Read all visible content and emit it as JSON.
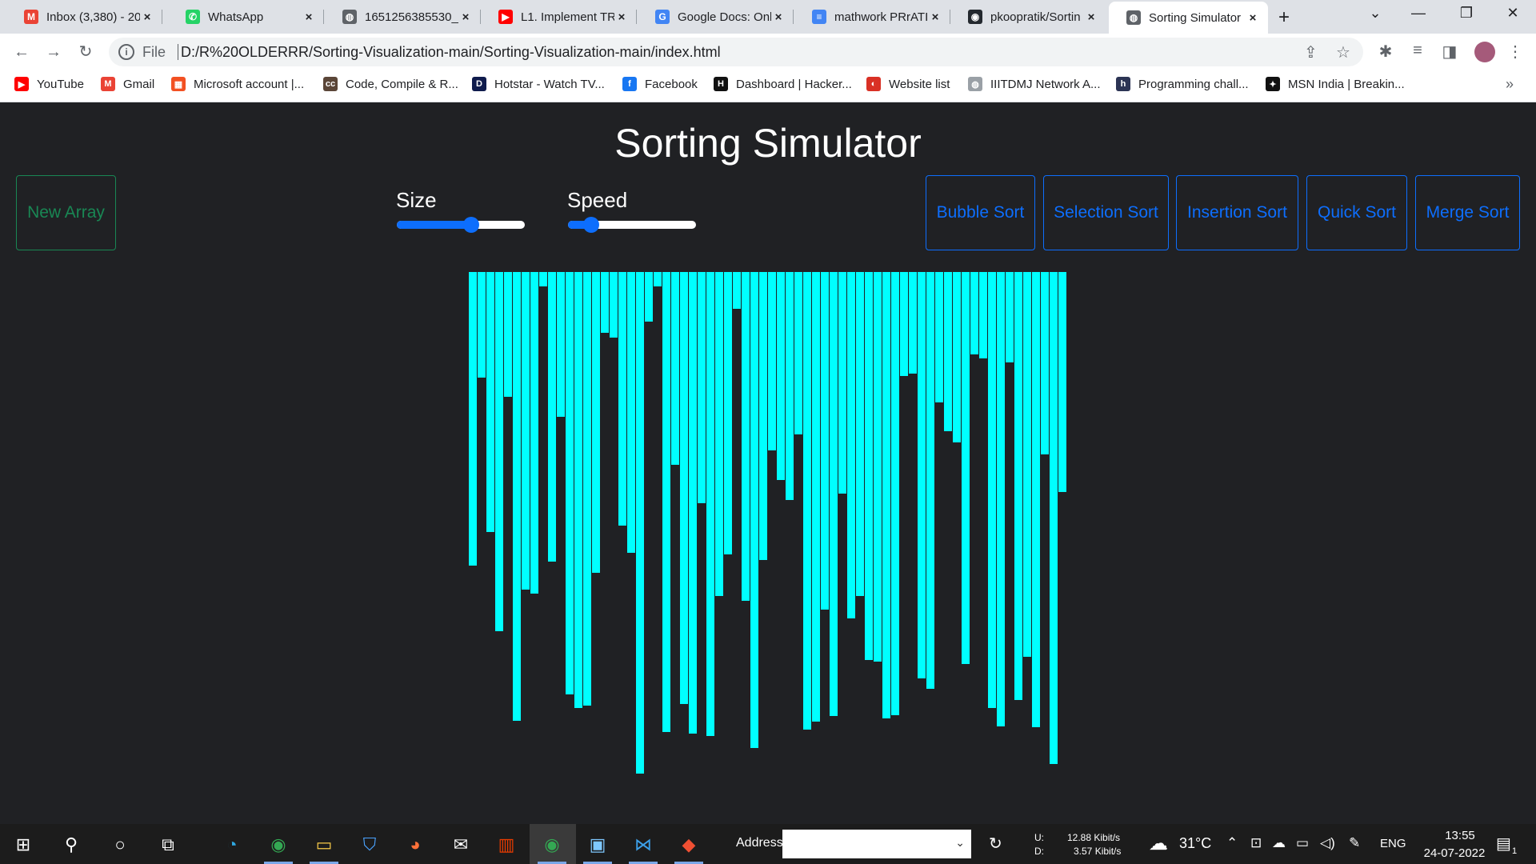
{
  "browser": {
    "tabs": [
      {
        "title": "Inbox (3,380) - 20",
        "icon": "gmail-icon",
        "color": "#ea4335",
        "glyph": "M"
      },
      {
        "title": "WhatsApp",
        "icon": "whatsapp-icon",
        "color": "#25d366",
        "glyph": "✆"
      },
      {
        "title": "1651256385530_[",
        "icon": "globe-icon",
        "color": "#5f6368",
        "glyph": "◍"
      },
      {
        "title": "L1. Implement TR",
        "icon": "youtube-icon",
        "color": "#ff0000",
        "glyph": "▶"
      },
      {
        "title": "Google Docs: Onl",
        "icon": "google-icon",
        "color": "#4285f4",
        "glyph": "G"
      },
      {
        "title": "mathwork PRrATI",
        "icon": "docs-icon",
        "color": "#4285f4",
        "glyph": "≡"
      },
      {
        "title": "pkoopratik/Sortin",
        "icon": "github-icon",
        "color": "#24292f",
        "glyph": "◉"
      },
      {
        "title": "Sorting Simulator",
        "icon": "globe-icon",
        "color": "#5f6368",
        "glyph": "◍",
        "active": true
      }
    ],
    "new_tab": "+",
    "window_controls": {
      "tab_search": "⌄",
      "minimize": "—",
      "restore": "❐",
      "close": "✕"
    },
    "nav": {
      "back": "←",
      "forward": "→",
      "reload": "↻"
    },
    "address": {
      "prefix": "File",
      "url": "D:/R%20OLDERRR/Sorting-Visualization-main/Sorting-Visualization-main/index.html"
    },
    "bookmarks": [
      {
        "label": "YouTube",
        "icon": "youtube-icon",
        "color": "#ff0000",
        "glyph": "▶"
      },
      {
        "label": "Gmail",
        "icon": "gmail-icon",
        "color": "#ea4335",
        "glyph": "M"
      },
      {
        "label": "Microsoft account |...",
        "icon": "microsoft-icon",
        "color": "#f25022",
        "glyph": "▦"
      },
      {
        "label": "Code, Compile & R...",
        "icon": "codechef-icon",
        "color": "#5b4638",
        "glyph": "cc"
      },
      {
        "label": "Hotstar - Watch TV...",
        "icon": "hotstar-icon",
        "color": "#0f1b4c",
        "glyph": "D"
      },
      {
        "label": "Facebook",
        "icon": "facebook-icon",
        "color": "#1877f2",
        "glyph": "f"
      },
      {
        "label": "Dashboard | Hacker...",
        "icon": "hackerrank-icon",
        "color": "#111111",
        "glyph": "H"
      },
      {
        "label": "Website list",
        "icon": "website-icon",
        "color": "#d93025",
        "glyph": "◐"
      },
      {
        "label": "IIITDMJ Network A...",
        "icon": "globe-icon",
        "color": "#9aa0a6",
        "glyph": "◍"
      },
      {
        "label": "Programming chall...",
        "icon": "hackerearth-icon",
        "color": "#2c3454",
        "glyph": "h"
      },
      {
        "label": "MSN India | Breakin...",
        "icon": "msn-icon",
        "color": "#111111",
        "glyph": "✦"
      }
    ],
    "more": "»"
  },
  "app": {
    "title": "Sorting Simulator",
    "new_array": "New Array",
    "size_label": "Size",
    "speed_label": "Speed",
    "size_value": 0.58,
    "speed_value": 0.18,
    "algorithms": [
      "Bubble Sort",
      "Selection Sort",
      "Insertion Sort",
      "Quick Sort",
      "Merge Sort"
    ],
    "colors": {
      "bar": "#00ffff",
      "accent_green": "#198754",
      "accent_blue": "#0d6efd",
      "background": "#202124"
    },
    "bar_values": [
      367,
      132,
      325,
      449,
      156,
      561,
      397,
      402,
      18,
      362,
      181,
      528,
      545,
      542,
      376,
      76,
      82,
      317,
      351,
      627,
      62,
      18,
      575,
      241,
      540,
      577,
      289,
      580,
      405,
      353,
      46,
      411,
      595,
      360,
      223,
      260,
      285,
      203,
      572,
      562,
      422,
      555,
      277,
      433,
      405,
      485,
      487,
      558,
      554,
      130,
      127,
      508,
      521,
      163,
      199,
      213,
      490,
      103,
      108,
      545,
      568,
      113,
      535,
      481,
      569,
      228,
      615,
      275
    ],
    "bar_max": 640
  },
  "taskbar": {
    "apps": [
      {
        "name": "start-icon",
        "glyph": "⊞"
      },
      {
        "name": "search-icon",
        "glyph": "⚲"
      },
      {
        "name": "cortana-icon",
        "glyph": "○"
      },
      {
        "name": "task-view-icon",
        "glyph": "⧉"
      },
      {
        "name": "edge-icon",
        "glyph": "◔",
        "color": "#2fa8e0"
      },
      {
        "name": "chrome-icon",
        "glyph": "◉",
        "color": "#34a853"
      },
      {
        "name": "file-explorer-icon",
        "glyph": "▭",
        "color": "#f7c948"
      },
      {
        "name": "store-icon",
        "glyph": "⛉",
        "color": "#4aa3ff"
      },
      {
        "name": "firefox-icon",
        "glyph": "◕",
        "color": "#ff7139"
      },
      {
        "name": "mail-icon",
        "glyph": "✉",
        "color": "#ffffff"
      },
      {
        "name": "office-icon",
        "glyph": "▥",
        "color": "#eb3c00"
      },
      {
        "name": "chrome-active-icon",
        "glyph": "◉",
        "color": "#34a853"
      },
      {
        "name": "app-icon",
        "glyph": "▣",
        "color": "#7ec8ff"
      },
      {
        "name": "vscode-icon",
        "glyph": "⋈",
        "color": "#3ca0ea"
      },
      {
        "name": "git-icon",
        "glyph": "◆",
        "color": "#f05033"
      }
    ],
    "address_label": "Address",
    "net_up_label": "U:",
    "net_up": "12.88 Kibit/s",
    "net_down_label": "D:",
    "net_down": "3.57 Kibit/s",
    "temperature": "31°C",
    "language": "ENG",
    "time": "13:55",
    "date": "24-07-2022",
    "notifications": "1"
  }
}
